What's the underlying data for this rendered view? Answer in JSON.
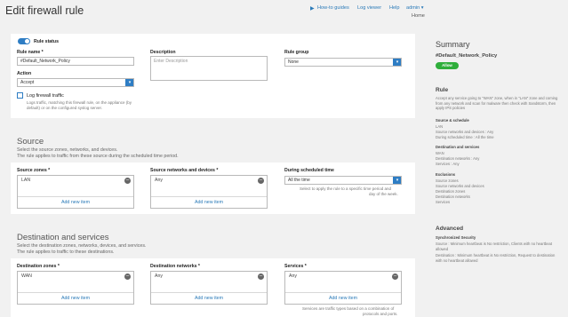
{
  "header": {
    "title": "Edit firewall rule",
    "nav": {
      "howto": "How-to guides",
      "logviewer": "Log viewer",
      "help": "Help",
      "admin": "admin ▾"
    },
    "breadcrumb": "Home"
  },
  "general": {
    "status_label": "Rule status",
    "rule_name_label": "Rule name *",
    "rule_name_value": "#Default_Network_Policy",
    "description_label": "Description",
    "description_placeholder": "Enter Description",
    "rule_group_label": "Rule group",
    "rule_group_value": "None",
    "action_label": "Action",
    "action_value": "Accept",
    "log_label": "Log firewall traffic",
    "log_help_1": "Logs traffic, matching this firewall rule, on the appliance (by",
    "log_help_2": "default) or on the configured syslog server."
  },
  "source": {
    "title": "Source",
    "desc_1": "Select the source zones, networks, and devices.",
    "desc_2": "The rule applies to traffic from these source during the scheduled time period.",
    "zones_label": "Source zones *",
    "zones_value": "LAN",
    "networks_label": "Source networks and devices *",
    "networks_value": "Any",
    "schedule_label": "During scheduled time",
    "schedule_value": "All the time",
    "schedule_help_1": "Select to apply the rule to a specific time period and",
    "schedule_help_2": "day of the week.",
    "add_new": "Add new item"
  },
  "destination": {
    "title": "Destination and services",
    "desc_1": "Select the destination zones, networks, devices, and services.",
    "desc_2": "The rule applies to traffic to these destinations.",
    "zones_label": "Destination zones *",
    "zones_value": "WAN",
    "networks_label": "Destination networks *",
    "networks_value": "Any",
    "services_label": "Services *",
    "services_value": "Any",
    "services_help_1": "Services are traffic types based on a combination of",
    "services_help_2": "protocols and ports.",
    "add_new": "Add new item"
  },
  "summary": {
    "title": "Summary",
    "name": "#Default_Network_Policy",
    "badge": "Allow",
    "rule_heading": "Rule",
    "rule_text": "Accept any service going to \"WAN\" zone, when in \"LAN\" zone and coming from any network and scan for malware then check with Sandstorm, then apply IPS policies",
    "src_sched_h": "Source & schedule",
    "src_sched_lines": [
      "LAN",
      "Source networks and devices : Any",
      "During scheduled time : All the time"
    ],
    "dst_srv_h": "Destination and services",
    "dst_srv_lines": [
      "WAN",
      "Destination networks : Any",
      "Services : Any"
    ],
    "excl_h": "Exclusions",
    "excl_lines": [
      "Source zones",
      "Source networks and devices",
      "Destination zones",
      "Destination networks",
      "Services"
    ],
    "adv_heading": "Advanced",
    "sync_h": "Synchronized Security",
    "sync_lines": [
      "Source : Minimum heartbeat is No restriction, Clients with no heartbeat allowed",
      "Destination : Minimum heartbeat is No restriction, Request to destination with no heartbeat allowed"
    ]
  },
  "colors": {
    "accent": "#2e7dc4",
    "allow": "#2fae3b",
    "link": "#2a7ab8"
  }
}
